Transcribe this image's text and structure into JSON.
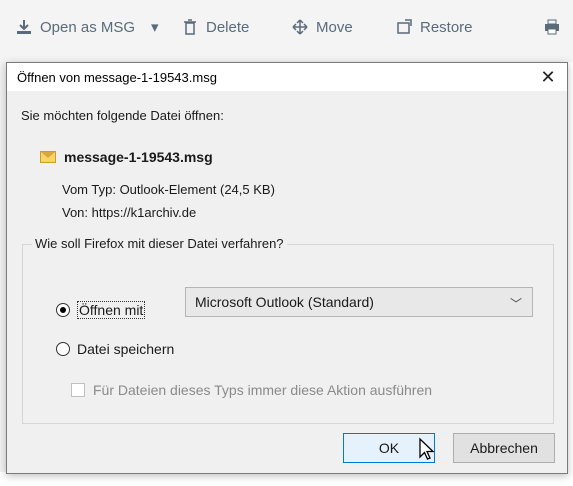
{
  "toolbar": {
    "open_msg": "Open as MSG",
    "delete": "Delete",
    "move": "Move",
    "restore": "Restore"
  },
  "dialog": {
    "title": "Öffnen von message-1-19543.msg",
    "close_label": "✕",
    "prompt": "Sie möchten folgende Datei öffnen:",
    "filename": "message-1-19543.msg",
    "type_line": "Vom Typ: Outlook-Element (24,5 KB)",
    "from_line": "Von: https://k1archiv.de",
    "group_label": "Wie soll Firefox mit dieser Datei verfahren?",
    "open_with": "Öffnen mit",
    "open_with_app": "Microsoft Outlook (Standard)",
    "save_file": "Datei speichern",
    "always_action": "Für Dateien dieses Typs immer diese Aktion ausführen",
    "ok": "OK",
    "cancel": "Abbrechen"
  }
}
